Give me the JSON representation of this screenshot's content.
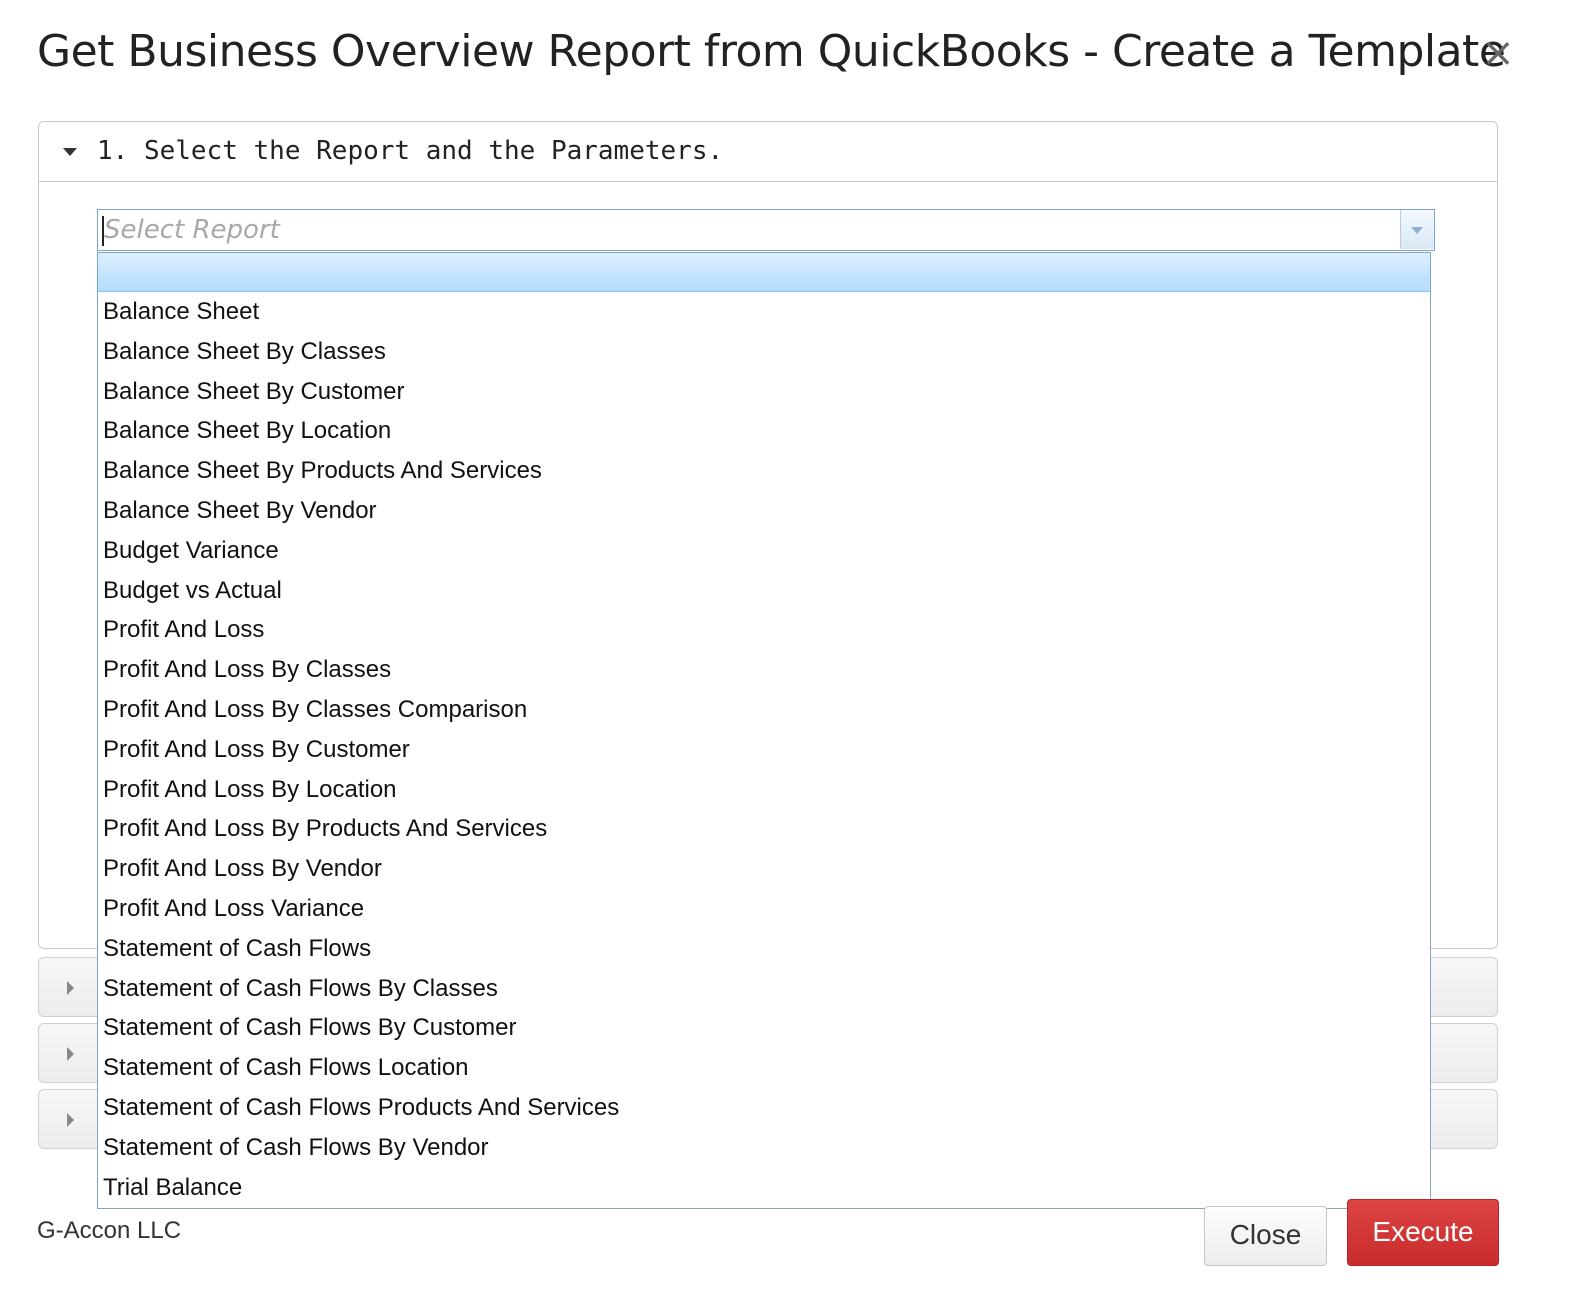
{
  "dialog": {
    "title": "Get Business Overview Report from QuickBooks - Create a Template",
    "close_icon": "×"
  },
  "step1": {
    "title": "1. Select the Report and the Parameters."
  },
  "report_select": {
    "placeholder": "Select Report",
    "value": "",
    "options": [
      "Balance Sheet",
      "Balance Sheet By Classes",
      "Balance Sheet By Customer",
      "Balance Sheet By Location",
      "Balance Sheet By Products And Services",
      "Balance Sheet By Vendor",
      "Budget Variance",
      "Budget vs Actual",
      "Profit And Loss",
      "Profit And Loss By Classes",
      "Profit And Loss By Classes Comparison",
      "Profit And Loss By Customer",
      "Profit And Loss By Location",
      "Profit And Loss By Products And Services",
      "Profit And Loss By Vendor",
      "Profit And Loss Variance",
      "Statement of Cash Flows",
      "Statement of Cash Flows By Classes",
      "Statement of Cash Flows By Customer",
      "Statement of Cash Flows Location",
      "Statement of Cash Flows Products And Services",
      "Statement of Cash Flows By Vendor",
      "Trial Balance"
    ]
  },
  "footer": {
    "company": "G-Accon LLC",
    "close_label": "Close",
    "execute_label": "Execute"
  },
  "colors": {
    "execute": "#d33a3a",
    "highlight": "#c3e3fd",
    "focus_border": "#7ea6c8"
  }
}
